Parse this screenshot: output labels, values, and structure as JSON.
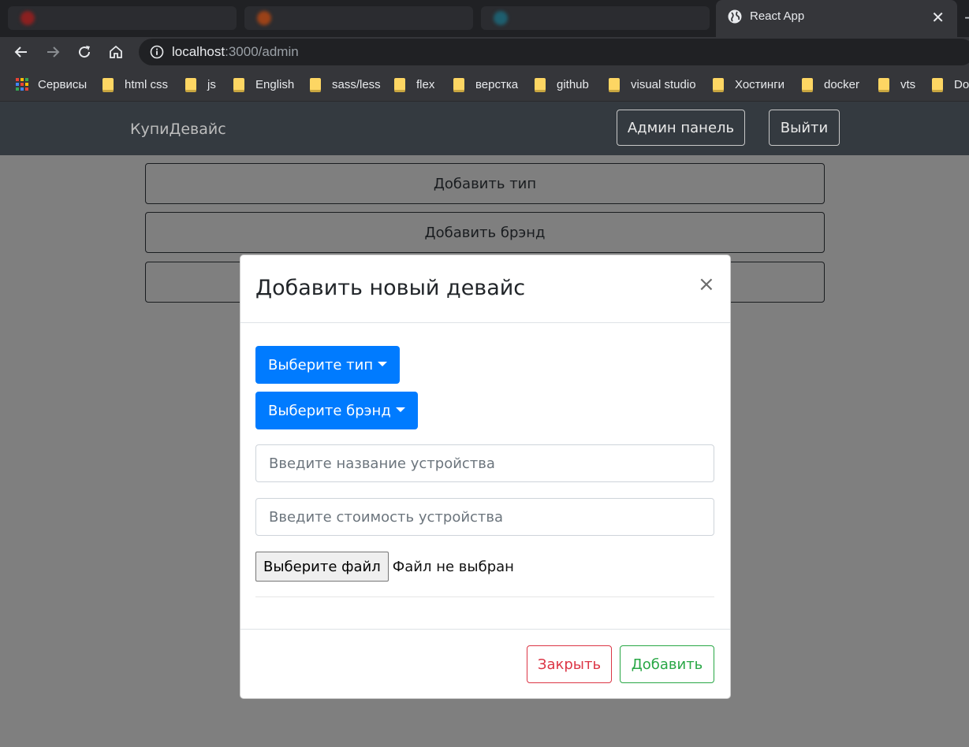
{
  "browser": {
    "tab_title": "React App",
    "tab_close": "✕",
    "new_tab": "+",
    "url_host": "localhost",
    "url_path": ":3000/admin",
    "bookmarks": [
      {
        "label": "Сервисы",
        "icon": "apps-icon"
      },
      {
        "label": "html css",
        "icon": "folder-icon"
      },
      {
        "label": "js",
        "icon": "folder-icon"
      },
      {
        "label": "English",
        "icon": "folder-icon"
      },
      {
        "label": "sass/less",
        "icon": "folder-icon"
      },
      {
        "label": "flex",
        "icon": "folder-icon"
      },
      {
        "label": "верстка",
        "icon": "folder-icon"
      },
      {
        "label": "github",
        "icon": "folder-icon"
      },
      {
        "label": "visual studio",
        "icon": "folder-icon"
      },
      {
        "label": "Хостинги",
        "icon": "folder-icon"
      },
      {
        "label": "docker",
        "icon": "folder-icon"
      },
      {
        "label": "vts",
        "icon": "folder-icon"
      },
      {
        "label": "Do",
        "icon": "folder-icon"
      }
    ]
  },
  "navbar": {
    "brand": "КупиДевайс",
    "admin_panel": "Админ панель",
    "logout": "Выйти"
  },
  "admin": {
    "add_type": "Добавить тип",
    "add_brand": "Добавить брэнд"
  },
  "modal": {
    "title": "Добавить новый девайс",
    "close_symbol": "×",
    "type_dropdown": "Выберите тип",
    "brand_dropdown": "Выберите брэнд",
    "name_placeholder": "Введите название устройства",
    "price_placeholder": "Введите стоимость устройства",
    "file_button": "Выберите файл",
    "file_status": "Файл не выбран",
    "close_button": "Закрыть",
    "add_button": "Добавить"
  },
  "colors": {
    "primary": "#007bff",
    "danger": "#dc3545",
    "success": "#28a745",
    "navbar": "#343a40"
  }
}
